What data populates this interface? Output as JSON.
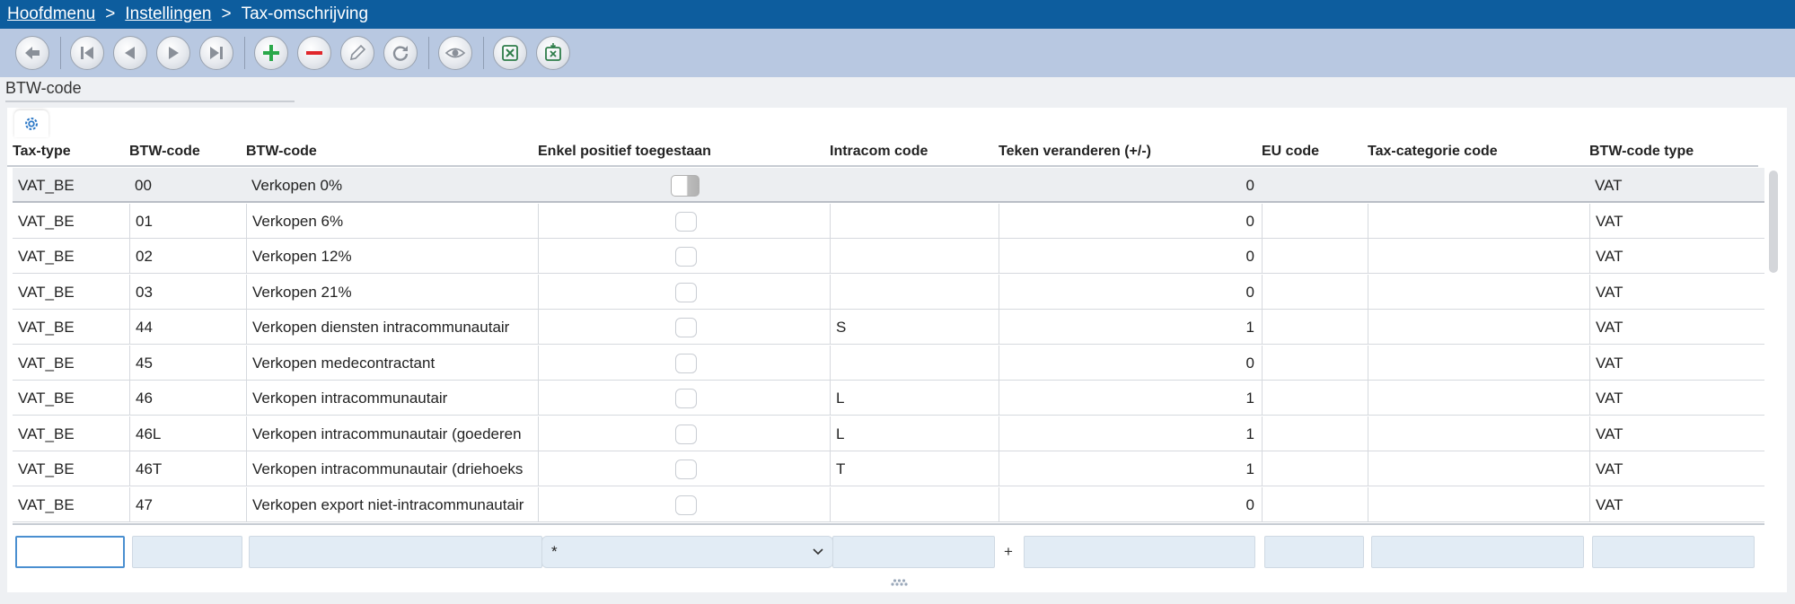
{
  "breadcrumb": {
    "items": [
      "Hoofdmenu",
      "Instellingen",
      "Tax-omschrijving"
    ],
    "separator": ">"
  },
  "toolbar": {
    "buttons": [
      "back-icon",
      "first-icon",
      "previous-icon",
      "next-icon",
      "last-icon",
      "add-icon",
      "delete-icon",
      "edit-icon",
      "refresh-icon",
      "view-icon",
      "excel-export-icon",
      "excel-import-icon"
    ],
    "colors": {
      "add": "#2aa84a",
      "delete": "#e0262b",
      "excel": "#2e7d4a",
      "gray": "#8a9099"
    }
  },
  "section": {
    "title": "BTW-code"
  },
  "colors": {
    "top_bar": "#0d5d9e",
    "toolbar": "#b8c8e1",
    "gear": "#2d79c7"
  },
  "grid": {
    "columns": [
      "Tax-type",
      "BTW-code",
      "BTW-code",
      "Enkel positief toegestaan",
      "Intracom code",
      "Teken veranderen (+/-)",
      "EU code",
      "Tax-categorie code",
      "BTW-code type"
    ],
    "rows": [
      {
        "tax_type": "VAT_BE",
        "code": "00",
        "description": "Verkopen 0%",
        "positive_only": false,
        "intracom": "",
        "sign_change": "0",
        "eu_code": "",
        "tax_category": "",
        "type": "VAT"
      },
      {
        "tax_type": "VAT_BE",
        "code": "01",
        "description": "Verkopen 6%",
        "positive_only": false,
        "intracom": "",
        "sign_change": "0",
        "eu_code": "",
        "tax_category": "",
        "type": "VAT"
      },
      {
        "tax_type": "VAT_BE",
        "code": "02",
        "description": "Verkopen 12%",
        "positive_only": false,
        "intracom": "",
        "sign_change": "0",
        "eu_code": "",
        "tax_category": "",
        "type": "VAT"
      },
      {
        "tax_type": "VAT_BE",
        "code": "03",
        "description": "Verkopen 21%",
        "positive_only": false,
        "intracom": "",
        "sign_change": "0",
        "eu_code": "",
        "tax_category": "",
        "type": "VAT"
      },
      {
        "tax_type": "VAT_BE",
        "code": "44",
        "description": "Verkopen diensten intracommunautair",
        "positive_only": false,
        "intracom": "S",
        "sign_change": "1",
        "eu_code": "",
        "tax_category": "",
        "type": "VAT"
      },
      {
        "tax_type": "VAT_BE",
        "code": "45",
        "description": "Verkopen medecontractant",
        "positive_only": false,
        "intracom": "",
        "sign_change": "0",
        "eu_code": "",
        "tax_category": "",
        "type": "VAT"
      },
      {
        "tax_type": "VAT_BE",
        "code": "46",
        "description": "Verkopen intracommunautair",
        "positive_only": false,
        "intracom": "L",
        "sign_change": "1",
        "eu_code": "",
        "tax_category": "",
        "type": "VAT"
      },
      {
        "tax_type": "VAT_BE",
        "code": "46L",
        "description": "Verkopen intracommunautair (goederen",
        "positive_only": false,
        "intracom": "L",
        "sign_change": "1",
        "eu_code": "",
        "tax_category": "",
        "type": "VAT"
      },
      {
        "tax_type": "VAT_BE",
        "code": "46T",
        "description": "Verkopen intracommunautair (driehoeks",
        "positive_only": false,
        "intracom": "T",
        "sign_change": "1",
        "eu_code": "",
        "tax_category": "",
        "type": "VAT"
      },
      {
        "tax_type": "VAT_BE",
        "code": "47",
        "description": "Verkopen export niet-intracommunautair",
        "positive_only": false,
        "intracom": "",
        "sign_change": "0",
        "eu_code": "",
        "tax_category": "",
        "type": "VAT"
      }
    ],
    "selected_row": 0
  },
  "filters": {
    "tax_type": "",
    "code": "",
    "description": "",
    "positive_only_select": "*",
    "intracom": "",
    "sign_change_prefix": "+",
    "sign_change": "",
    "eu_code": "",
    "tax_category": "",
    "type": ""
  }
}
